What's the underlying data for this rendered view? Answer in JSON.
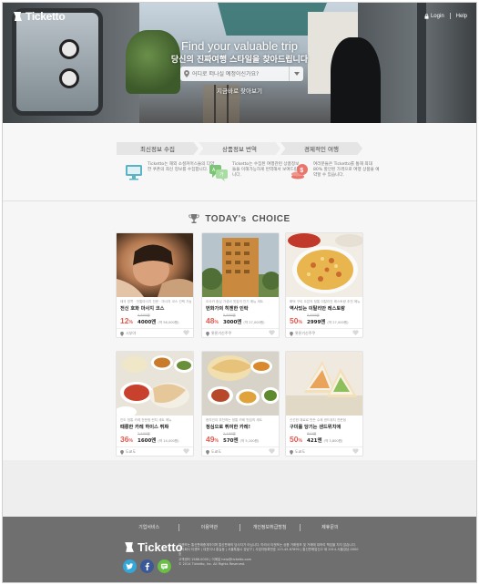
{
  "brand": {
    "name": "Ticketto"
  },
  "top_nav": {
    "login": "Login",
    "help": "Help"
  },
  "hero": {
    "title": "Find your valuable trip",
    "subtitle": "당신의 진짜여행 스타일을 찾아드립니다",
    "search_placeholder": "어디로 떠나실 예정이신가요?",
    "cta": "지금바로 찾아보기"
  },
  "features": {
    "steps": [
      "최신정보 수집",
      "상품정보 번역",
      "경제적인 여행"
    ],
    "items": [
      {
        "icon": "monitor-icon",
        "text": "Ticketto는 해외 소셜커머스들의 다양한 쿠폰의 최신 정보를 수집합니다."
      },
      {
        "icon": "translate-icon",
        "text": "Ticketto는 수집된 여행관련 상품정보들을 이해가능하게 번역해서 보여드립니다."
      },
      {
        "icon": "money-icon",
        "text": "여러분들은 Ticketto를 통해 최대 80% 할인된 가격으로 여행 상품을 예약할 수 있습니다."
      }
    ],
    "colors": {
      "blue": "#5ab4c5",
      "green": "#7cc576",
      "red": "#e8766c"
    }
  },
  "todays_choice": {
    "prefix": "TODAY's",
    "suffix": "CHOICE",
    "cards": [
      {
        "desc": "태국 방콕 · 전통마사지 전문 · 마사지 코스 선택 가능",
        "name": "전신 호화 마사지 코스",
        "discount": "12",
        "original": "4,800엔",
        "price": "4000엔",
        "price_sub": "(약 56,000원)",
        "location": "시부야"
      },
      {
        "desc": "오사카 중심 가성비 맛집의 인기 메뉴 세트",
        "name": "번화가의 히젠한 인락",
        "discount": "48",
        "original": "5,800엔",
        "price": "3000엔",
        "price_sub": "(약 27,000원)",
        "location": "롯폰기신주쿠"
      },
      {
        "desc": "화덕 구이 오븐의 정통 이탈리안 레스토랑 추천 메뉴",
        "name": "역사있는 이탈리안 레스토랑",
        "discount": "50",
        "original": "5,800엔",
        "price": "2999엔",
        "price_sub": "(약 27,000원)",
        "location": "롯폰기신주쿠"
      },
      {
        "desc": "인도 정통 카레 전문점 런치 세트 메뉴",
        "name": "때롱한 카레 하이스 튀쨔",
        "discount": "36",
        "original": "2,500엔",
        "price": "1600엔",
        "price_sub": "(약 14,000원)",
        "location": "도쿄도"
      },
      {
        "desc": "현지인이 추천하는 정통 카레 맛집의 세트",
        "name": "정심으로 튀여한 카레!",
        "discount": "49",
        "original": "1,100엔",
        "price": "570엔",
        "price_sub": "(약 5,100원)",
        "location": "도쿄도"
      },
      {
        "desc": "신선한 재료로 만든 수제 샌드위치 전문점",
        "name": "구미를 당기는 샌드위치애",
        "discount": "50",
        "original": "840엔",
        "price": "421엔",
        "price_sub": "(약 3,800원)",
        "location": "도쿄도"
      }
    ]
  },
  "footer": {
    "links": [
      "기업서비스",
      "이용약관",
      "개인정보취급방침",
      "제휴문의"
    ],
    "info": [
      "티켓또는 통신판매중개자이며 통신판매의 당사자가 아닙니다. 따라서 티켓또는 상품 거래정보 및 거래에 대하여 책임을 지지 않습니다.",
      "주식회사 티켓또 | 대표이사 홍길동 | 서울특별시 강남구 | 사업자등록번호 123-45-67890 | 통신판매업신고 제 2014-서울강남-0000호",
      "고객센터 1588-0000 | 이메일 help@ticketto.com",
      "© 2014 Ticketto, Inc. All Rights Reserved."
    ],
    "social": [
      "twitter",
      "facebook",
      "chat"
    ]
  }
}
